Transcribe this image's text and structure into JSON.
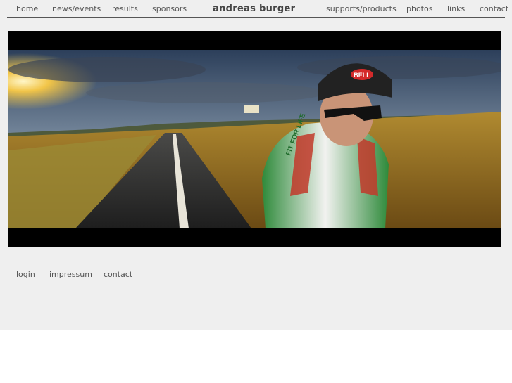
{
  "header": {
    "nav_left": [
      "home",
      "news/events",
      "results",
      "sponsors"
    ],
    "brand": "andreas burger",
    "nav_right": [
      "supports/products",
      "photos",
      "links",
      "contact"
    ]
  },
  "banner": {
    "jersey_text": "FIT FOR LIFE",
    "helmet_text": "BELL"
  },
  "footer": {
    "links": [
      "login",
      "impressum",
      "contact"
    ]
  }
}
